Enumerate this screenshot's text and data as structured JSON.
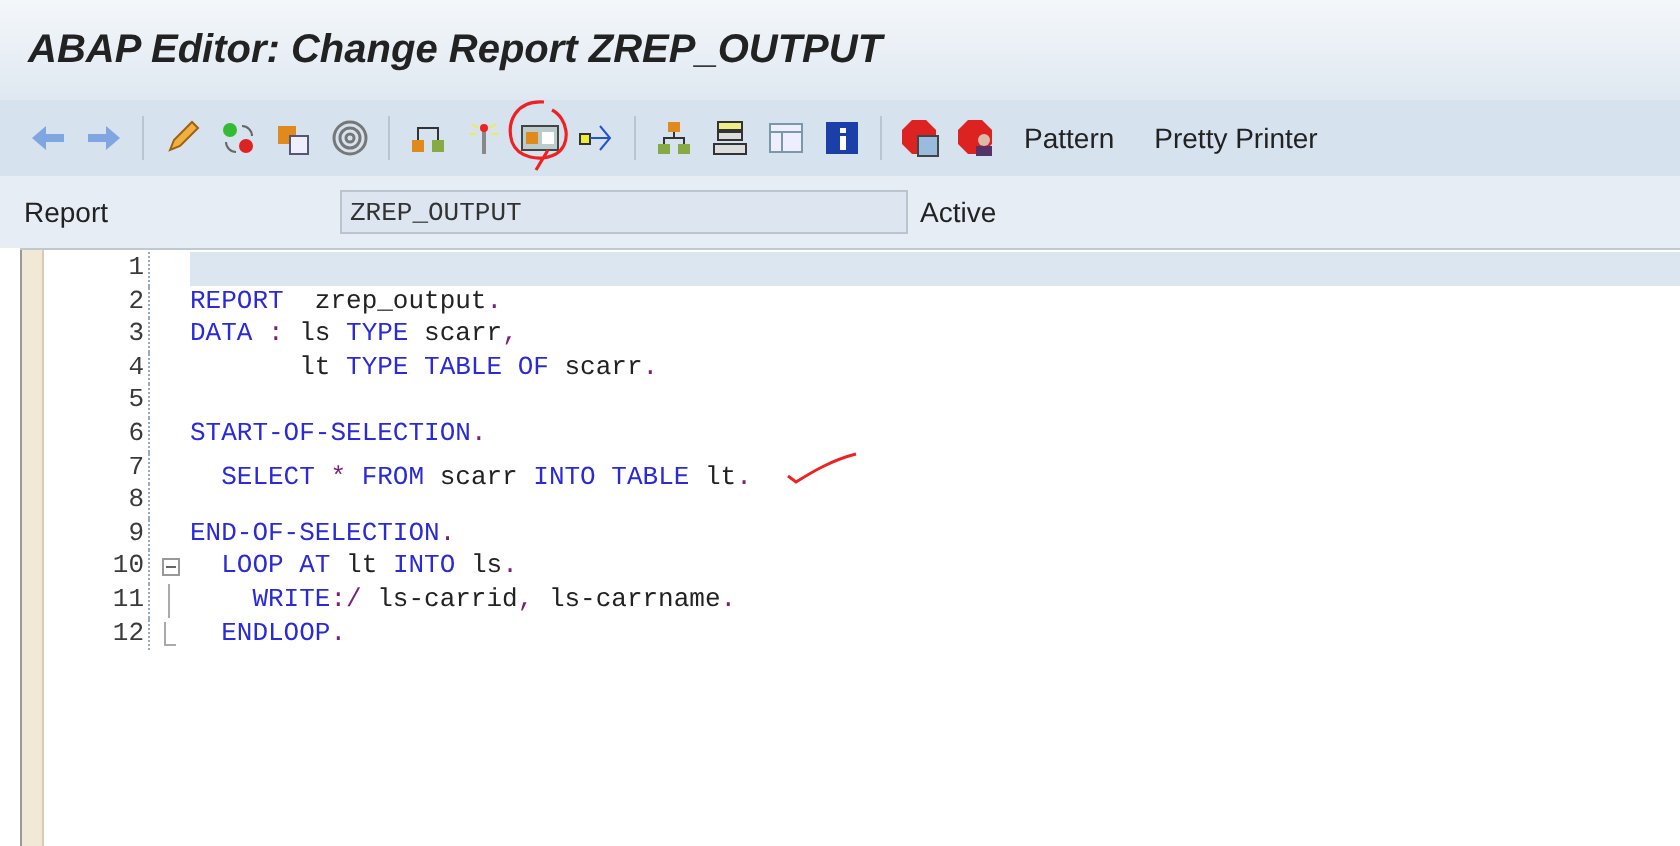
{
  "window": {
    "title": "ABAP Editor: Change Report ZREP_OUTPUT"
  },
  "toolbar": {
    "icons": [
      {
        "circled": false
      },
      {
        "circled": false
      },
      {
        "circled": false
      },
      {
        "circled": false
      },
      {
        "circled": false
      },
      {
        "circled": false
      },
      {
        "circled": false
      },
      {
        "circled": false
      },
      {
        "circled": true
      },
      {
        "circled": false
      },
      {
        "circled": false
      },
      {
        "circled": false
      },
      {
        "circled": false
      },
      {
        "circled": false
      },
      {
        "circled": false
      },
      {
        "circled": false
      }
    ],
    "text_buttons": [
      "Pattern",
      "Pretty Printer"
    ]
  },
  "header": {
    "label": "Report",
    "value": "ZREP_OUTPUT",
    "status": "Active"
  },
  "editor": {
    "lines": [
      {
        "number": "1",
        "selected": true,
        "kind": "plain"
      },
      {
        "number": "2",
        "selected": false,
        "kind": "plain",
        "tokens": [
          {
            "text": "REPORT",
            "kind": "keyword"
          },
          {
            "text": "  zrep_output",
            "kind": "identifier"
          },
          {
            "text": ".",
            "kind": "operator"
          }
        ]
      },
      {
        "number": "3",
        "selected": false,
        "kind": "plain",
        "tokens": [
          {
            "text": "DATA",
            "kind": "keyword"
          },
          {
            "text": " : ",
            "kind": "operator"
          },
          {
            "text": "ls ",
            "kind": "identifier"
          },
          {
            "text": "TYPE",
            "kind": "keyword"
          },
          {
            "text": " scarr",
            "kind": "identifier"
          },
          {
            "text": ",",
            "kind": "operator"
          }
        ]
      },
      {
        "number": "4",
        "selected": false,
        "kind": "plain",
        "tokens": [
          {
            "text": "       lt ",
            "kind": "identifier"
          },
          {
            "text": "TYPE TABLE OF",
            "kind": "keyword"
          },
          {
            "text": " scarr",
            "kind": "identifier"
          },
          {
            "text": ".",
            "kind": "operator"
          }
        ]
      },
      {
        "number": "5",
        "selected": false,
        "kind": "plain"
      },
      {
        "number": "6",
        "selected": false,
        "kind": "plain",
        "tokens": [
          {
            "text": "START-OF-SELECTION",
            "kind": "keyword"
          },
          {
            "text": ".",
            "kind": "operator"
          }
        ]
      },
      {
        "number": "7",
        "selected": false,
        "kind": "plain",
        "ticked": true,
        "tokens": [
          {
            "text": "  SELECT",
            "kind": "keyword"
          },
          {
            "text": " * ",
            "kind": "operator"
          },
          {
            "text": "FROM",
            "kind": "keyword"
          },
          {
            "text": " scarr ",
            "kind": "identifier"
          },
          {
            "text": "INTO TABLE",
            "kind": "keyword"
          },
          {
            "text": " lt",
            "kind": "identifier"
          },
          {
            "text": ".",
            "kind": "operator"
          }
        ]
      },
      {
        "number": "8",
        "selected": false,
        "kind": "plain"
      },
      {
        "number": "9",
        "selected": false,
        "kind": "plain",
        "tokens": [
          {
            "text": "END-OF-SELECTION",
            "kind": "keyword"
          },
          {
            "text": ".",
            "kind": "operator"
          }
        ]
      },
      {
        "number": "10",
        "selected": false,
        "kind": "fold-start",
        "tokens": [
          {
            "text": "  LOOP AT",
            "kind": "keyword"
          },
          {
            "text": " lt ",
            "kind": "identifier"
          },
          {
            "text": "INTO",
            "kind": "keyword"
          },
          {
            "text": " ls",
            "kind": "identifier"
          },
          {
            "text": ".",
            "kind": "operator"
          }
        ]
      },
      {
        "number": "11",
        "selected": false,
        "kind": "fold-inside",
        "tokens": [
          {
            "text": "    WRITE",
            "kind": "keyword"
          },
          {
            "text": ":/ ",
            "kind": "operator"
          },
          {
            "text": "ls-carrid",
            "kind": "identifier"
          },
          {
            "text": ", ",
            "kind": "operator"
          },
          {
            "text": "ls-carrname",
            "kind": "identifier"
          },
          {
            "text": ".",
            "kind": "operator"
          }
        ]
      },
      {
        "number": "12",
        "selected": false,
        "kind": "fold-end",
        "tokens": [
          {
            "text": "  ENDLOOP",
            "kind": "keyword"
          },
          {
            "text": ".",
            "kind": "operator"
          }
        ]
      }
    ]
  }
}
